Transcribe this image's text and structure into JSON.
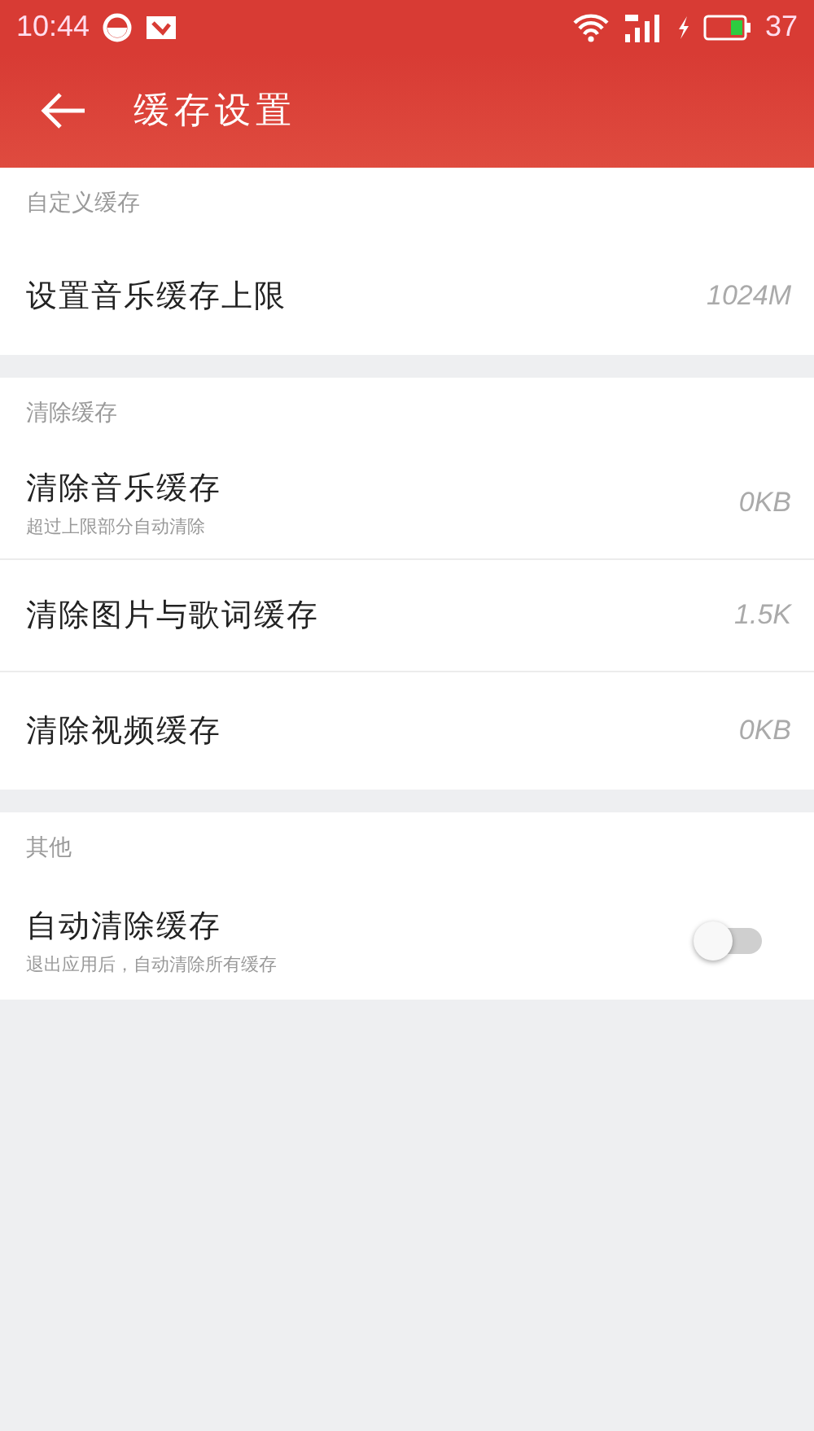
{
  "status_bar": {
    "time": "10:44",
    "battery": "37"
  },
  "header": {
    "title": "缓存设置"
  },
  "sections": [
    {
      "title": "自定义缓存",
      "rows": [
        {
          "kind": "value",
          "label": "设置音乐缓存上限",
          "value": "1024M"
        }
      ]
    },
    {
      "title": "清除缓存",
      "rows": [
        {
          "kind": "value",
          "label": "清除音乐缓存",
          "subtitle": "超过上限部分自动清除",
          "value": "0KB"
        },
        {
          "kind": "value",
          "label": "清除图片与歌词缓存",
          "value": "1.5K"
        },
        {
          "kind": "value",
          "label": "清除视频缓存",
          "value": "0KB"
        }
      ]
    },
    {
      "title": "其他",
      "rows": [
        {
          "kind": "toggle",
          "label": "自动清除缓存",
          "subtitle": "退出应用后，自动清除所有缓存",
          "on": false
        }
      ]
    }
  ]
}
